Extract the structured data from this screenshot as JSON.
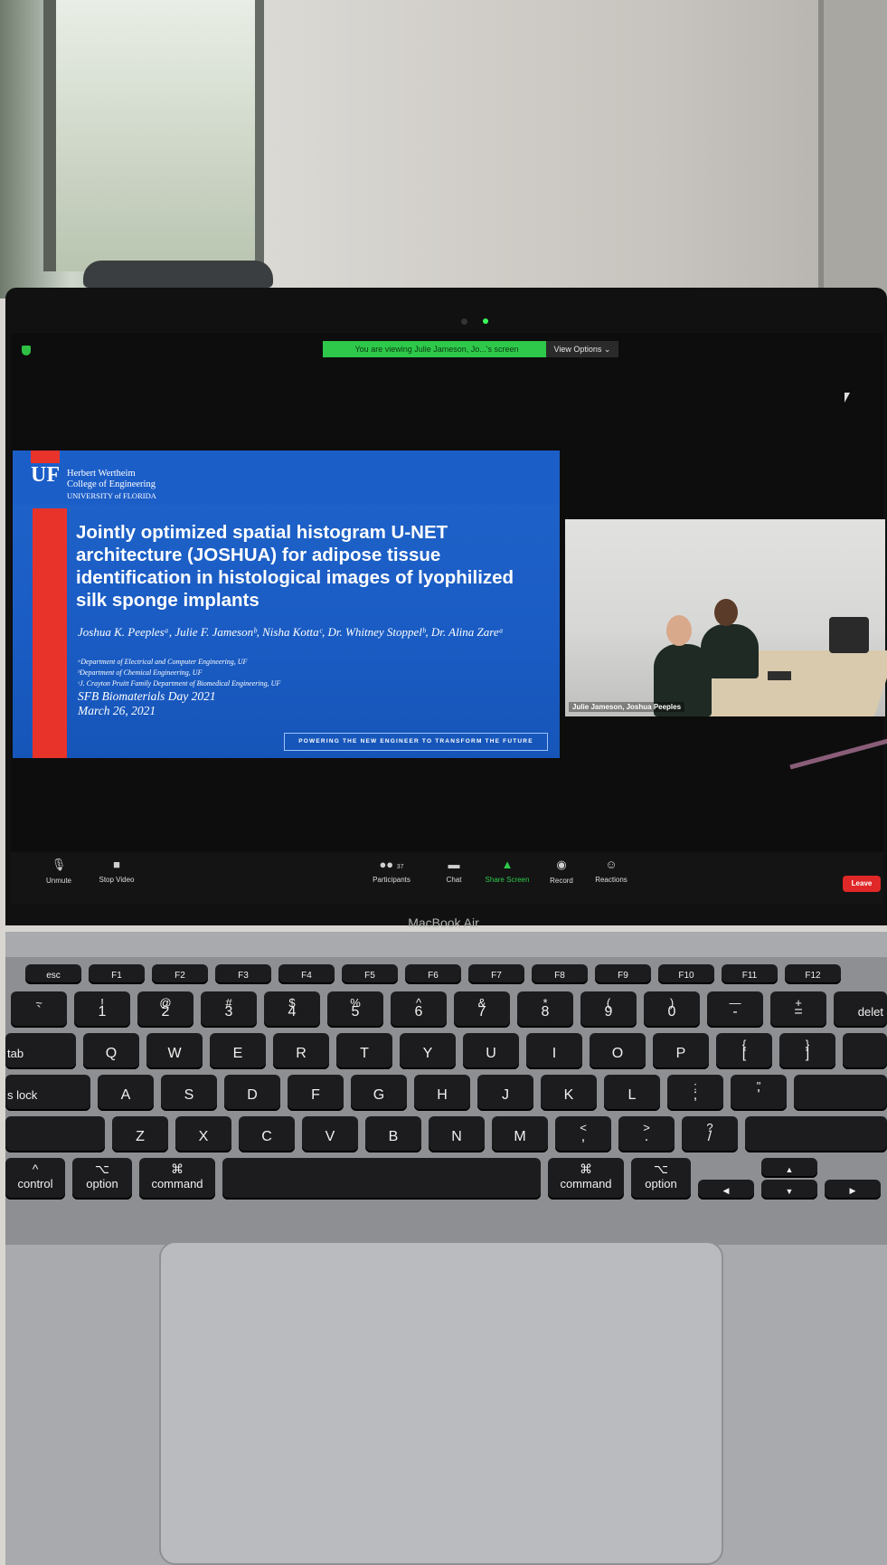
{
  "zoom": {
    "banner": "You are viewing Julie Jameson, Jo...'s screen",
    "view_options": "View Options ⌄",
    "participant_video_label": "Julie Jameson, Joshua Peeples",
    "toolbar": {
      "unmute": "Unmute",
      "stop_video": "Stop Video",
      "participants": "Participants",
      "participants_count": "37",
      "chat": "Chat",
      "share_screen": "Share Screen",
      "record": "Record",
      "reactions": "Reactions",
      "leave": "Leave"
    }
  },
  "slide": {
    "logo": "UF",
    "college_line1": "Herbert Wertheim",
    "college_line2": "College of Engineering",
    "university": "UNIVERSITY of FLORIDA",
    "title": "Jointly optimized spatial histogram U-NET architecture (JOSHUA) for adipose tissue identification in histological images of lyophilized silk sponge implants",
    "authors": "Joshua K. Peeplesᵃ, Julie F. Jamesonᵇ, Nisha Kottaᶜ, Dr. Whitney Stoppelᵇ, Dr. Alina Zareᵃ",
    "affil_a": "ᵃDepartment of Electrical and Computer Engineering, UF",
    "affil_b": "ᵇDepartment of Chemical Engineering, UF",
    "affil_c": "ᶜJ. Crayton Pruitt Family Department of Biomedical Engineering, UF",
    "event": "SFB Biomaterials Day 2021",
    "date": "March 26, 2021",
    "tagline": "POWERING THE NEW ENGINEER TO TRANSFORM THE FUTURE"
  },
  "laptop_label": "MacBook Air",
  "keys": {
    "esc": "esc",
    "f": [
      "F1",
      "F2",
      "F3",
      "F4",
      "F5",
      "F6",
      "F7",
      "F8",
      "F9",
      "F10",
      "F11",
      "F12"
    ],
    "num_top": [
      "~",
      "!",
      "@",
      "#",
      "$",
      "%",
      "^",
      "&",
      "*",
      "(",
      ")",
      "—",
      "+"
    ],
    "num_main": [
      "`",
      "1",
      "2",
      "3",
      "4",
      "5",
      "6",
      "7",
      "8",
      "9",
      "0",
      "-",
      "="
    ],
    "delete": "delet",
    "tab": "tab",
    "row_q": [
      "Q",
      "W",
      "E",
      "R",
      "T",
      "Y",
      "U",
      "I",
      "O",
      "P"
    ],
    "br_top": [
      "{",
      "}"
    ],
    "br_main": [
      "[",
      "]"
    ],
    "caps": "s lock",
    "row_a": [
      "A",
      "S",
      "D",
      "F",
      "G",
      "H",
      "J",
      "K",
      "L"
    ],
    "semi_top": ":",
    "semi_main": ";",
    "quote_top": "\"",
    "quote_main": "'",
    "row_z": [
      "Z",
      "X",
      "C",
      "V",
      "B",
      "N",
      "M"
    ],
    "lt_top": "<",
    "lt_main": ",",
    "gt_top": ">",
    "gt_main": ".",
    "q_top": "?",
    "q_main": "/",
    "control": "control",
    "option": "option",
    "command": "command",
    "cmd_sym": "⌘",
    "opt_sym": "⌥",
    "ctrl_sym": "^"
  }
}
